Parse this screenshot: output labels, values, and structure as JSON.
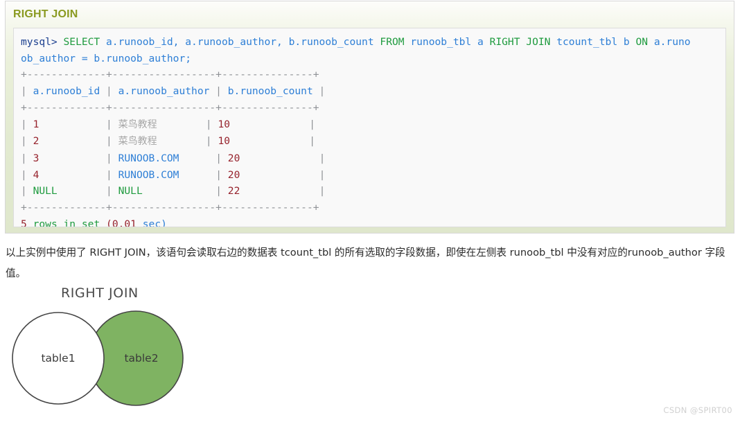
{
  "panel": {
    "title": "RIGHT JOIN",
    "accent_color": "#8a9a20",
    "background_color": "#e2ead0"
  },
  "code": {
    "prompt": "mysql>",
    "query_line1_kw1": " SELECT",
    "query_line1": " a.runoob_id, a.runoob_author, b.runoob_count ",
    "query_kw_from": "FROM",
    "query_tbl_a": " runoob_tbl a ",
    "query_kw_right_join": "RIGHT JOIN",
    "query_tbl_b": " tcount_tbl b ",
    "query_kw_on": "ON",
    "query_tail": " a.runo",
    "query_line2": "ob_author = b.runoob_author;",
    "rule_top": "+-------------+-----------------+---------------+",
    "rule_mid": "+-------------+-----------------+---------------+",
    "rule_bottom": "+-------------+-----------------+---------------+",
    "headers": [
      "a.runoob_id",
      "a.runoob_author",
      "b.runoob_count"
    ],
    "rows": [
      {
        "id": "1",
        "id_kind": "num",
        "author": "菜鸟教程",
        "author_kind": "cjk",
        "count": "10"
      },
      {
        "id": "2",
        "id_kind": "num",
        "author": "菜鸟教程",
        "author_kind": "cjk",
        "count": "10"
      },
      {
        "id": "3",
        "id_kind": "num",
        "author": "RUNOOB.COM",
        "author_kind": "blue",
        "count": "20"
      },
      {
        "id": "4",
        "id_kind": "num",
        "author": "RUNOOB.COM",
        "author_kind": "blue",
        "count": "20"
      },
      {
        "id": "NULL",
        "id_kind": "null",
        "author": "NULL",
        "author_kind": "null",
        "count": "22"
      }
    ],
    "footer_count": "5",
    "footer_text": " rows in set ",
    "footer_time": "(0.01",
    "footer_unit": " sec)"
  },
  "description": {
    "text": "以上实例中使用了 RIGHT JOIN，该语句会读取右边的数据表 tcount_tbl 的所有选取的字段数据，即使在左侧表 runoob_tbl 中没有对应的runoob_author 字段值。"
  },
  "venn": {
    "caption": "RIGHT JOIN",
    "left_label": "table1",
    "right_label": "table2",
    "left_fill": "#ffffff",
    "right_fill": "#7fb362",
    "stroke": "#444444"
  },
  "watermark": {
    "text": "CSDN @SPIRT00"
  }
}
